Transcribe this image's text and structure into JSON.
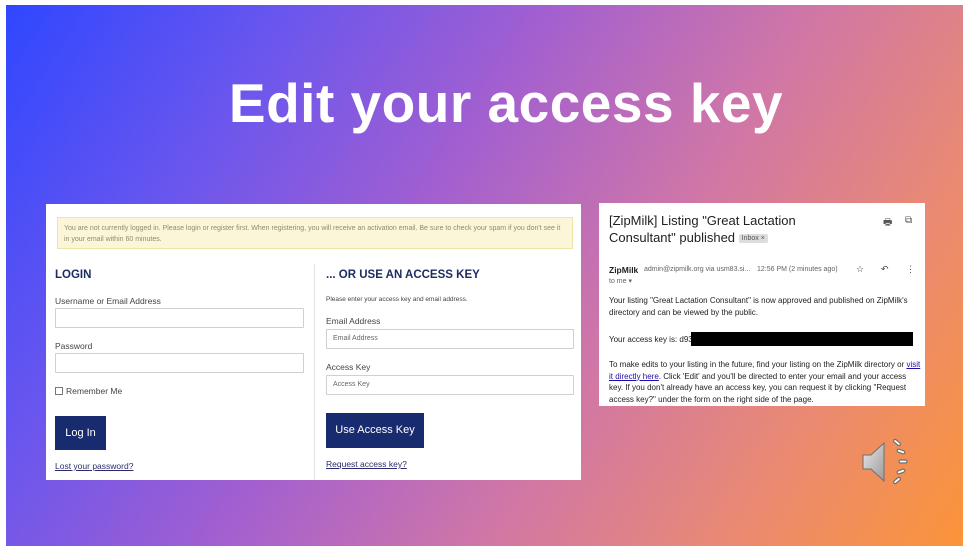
{
  "slide": {
    "title": "Edit your access key"
  },
  "login_screen": {
    "notice": "You are not currently logged in. Please login or register first. When registering, you will receive an activation email. Be sure to check your spam if you don't see it in your email within 60 minutes.",
    "login": {
      "heading": "LOGIN",
      "username_label": "Username or Email Address",
      "username_value": "",
      "password_label": "Password",
      "password_value": "",
      "remember_label": "Remember Me",
      "login_button": "Log In",
      "lost_password_link": "Lost your password?"
    },
    "access_key": {
      "heading": "... OR USE AN ACCESS KEY",
      "instructions": "Please enter your access key and email address.",
      "email_label": "Email Address",
      "email_placeholder": "Email Address",
      "key_label": "Access Key",
      "key_placeholder": "Access Key",
      "use_button": "Use Access Key",
      "request_link": "Request access key?"
    }
  },
  "email": {
    "subject": "[ZipMilk] Listing \"Great Lactation Consultant\" published",
    "label": "Inbox ×",
    "sender_name": "ZipMilk",
    "sender_address": "admin@zipmilk.org via usm83.si...",
    "time": "12:56 PM (2 minutes ago)",
    "to": "to me ▾",
    "para1": "Your listing \"Great Lactation Consultant\" is now approved and published on ZipMilk's directory and can be viewed by the public.",
    "access_key_prefix": "Your access key is: d93",
    "para3_before": "To make edits to your listing in the future, find your listing on the ZipMilk directory or ",
    "para3_link": "visit it directly here",
    "para3_after": ". Click 'Edit' and you'll be directed to enter your email and your access key. If you don't already have an access key, you can request it by clicking \"Request access key?\" under the form on the right side of the page.",
    "icons": [
      "print-icon",
      "open-external-icon",
      "star-icon",
      "reply-icon",
      "more-icon"
    ]
  },
  "audio": {
    "icon": "speaker-icon"
  }
}
